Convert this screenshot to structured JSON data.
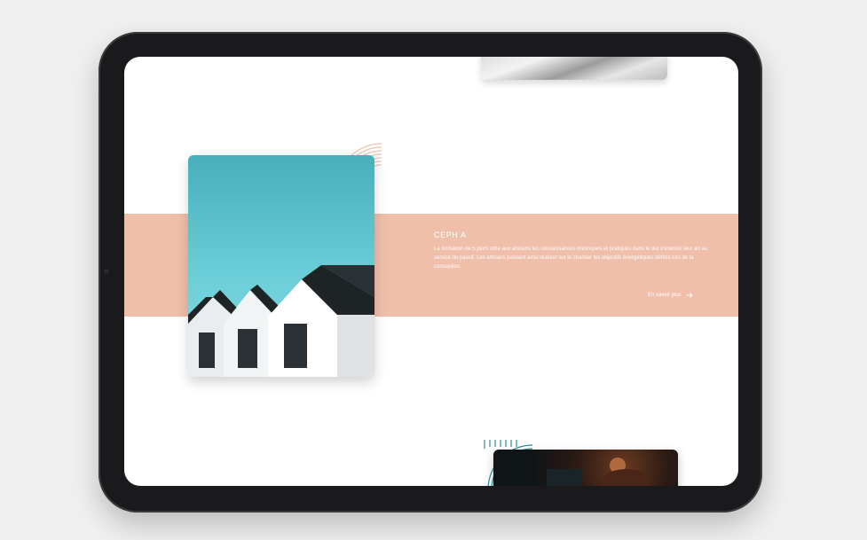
{
  "section": {
    "title": "CEPH A",
    "description": "La formation de 5 jours offre aux artisans les connaissances théoriques et pratiques dans le but d'exercer leur art au service du passif. Les artisans peuvent ainsi réaliser sur le chantier les objectifs énergétiques définis lors de la conception.",
    "cta_label": "En savoir plus"
  },
  "icons": {
    "cta": "arrow-right-icon"
  },
  "colors": {
    "band": "#efbfaa",
    "accent_arcs_top": "#efbfaa",
    "accent_arcs_bottom": "#2e8f95"
  }
}
